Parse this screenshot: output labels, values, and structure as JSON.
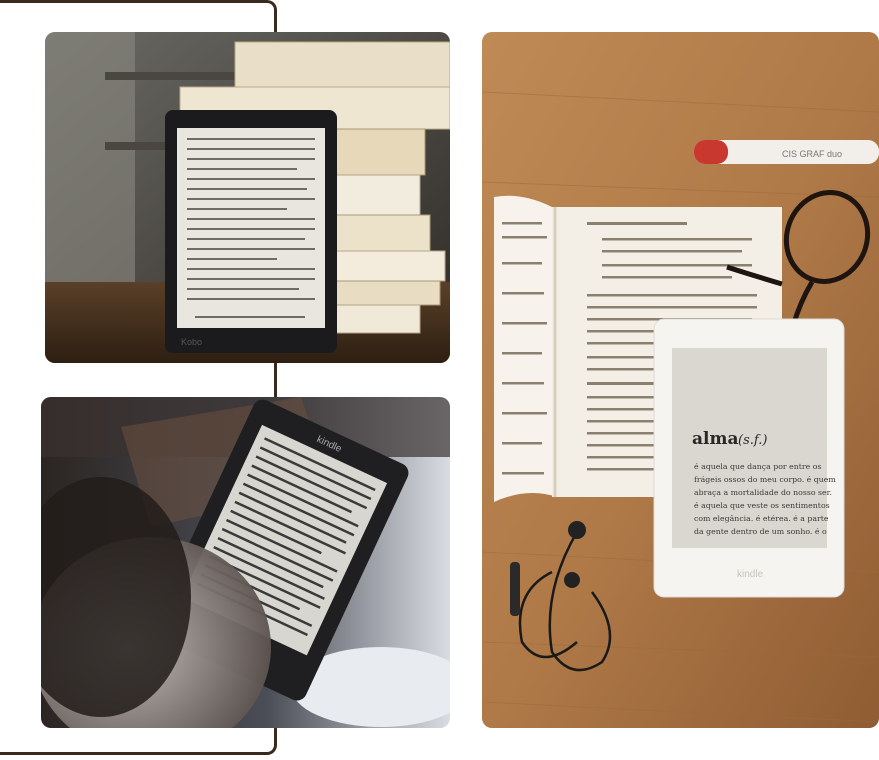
{
  "photos": [
    {
      "subject": "ereader-with-book-stack"
    },
    {
      "subject": "reading-kindle"
    },
    {
      "subject": "kindle-alma-flatlay"
    }
  ],
  "photo1": {
    "brand": "Kobo"
  },
  "photo2": {
    "brand": "kindle"
  },
  "photo3": {
    "brand": "kindle",
    "word": "alma",
    "word_class": "(s.f.)",
    "definition": [
      "é aquela que dança por entre os",
      "frágeis ossos do meu corpo. é quem",
      "abraça a mortalidade do nosso ser.",
      "é aquela que veste os sentimentos",
      "com elegância. é etérea. é a parte",
      "da gente dentro de um sonho. é o"
    ],
    "marker_label": "CIS GRAF duo"
  },
  "colors": {
    "frame": "#3a2a1e",
    "wood": "#b07a48",
    "paper": "#f4efe6"
  }
}
